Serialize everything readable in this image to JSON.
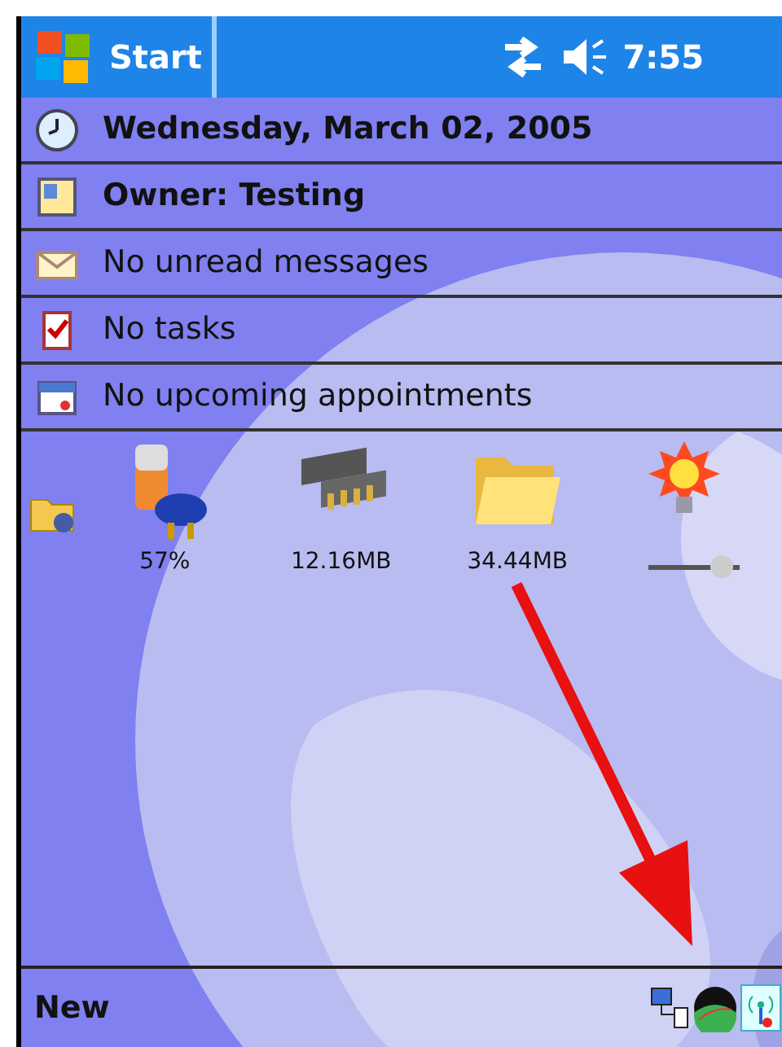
{
  "title_bar": {
    "start_label": "Start",
    "time": "7:55"
  },
  "today_items": [
    {
      "kind": "date",
      "text": "Wednesday, March 02, 2005",
      "bold": true
    },
    {
      "kind": "owner",
      "text": "Owner: Testing",
      "bold": true
    },
    {
      "kind": "messages",
      "text": "No unread messages",
      "bold": false
    },
    {
      "kind": "tasks",
      "text": "No tasks",
      "bold": false
    },
    {
      "kind": "appointments",
      "text": "No upcoming appointments",
      "bold": false
    }
  ],
  "status_items": [
    {
      "kind": "battery",
      "reading": "57%"
    },
    {
      "kind": "memory",
      "reading": "12.16MB"
    },
    {
      "kind": "storage",
      "reading": "34.44MB"
    },
    {
      "kind": "backlight",
      "level": 0.8
    }
  ],
  "menu_bar": {
    "left_label": "New"
  }
}
